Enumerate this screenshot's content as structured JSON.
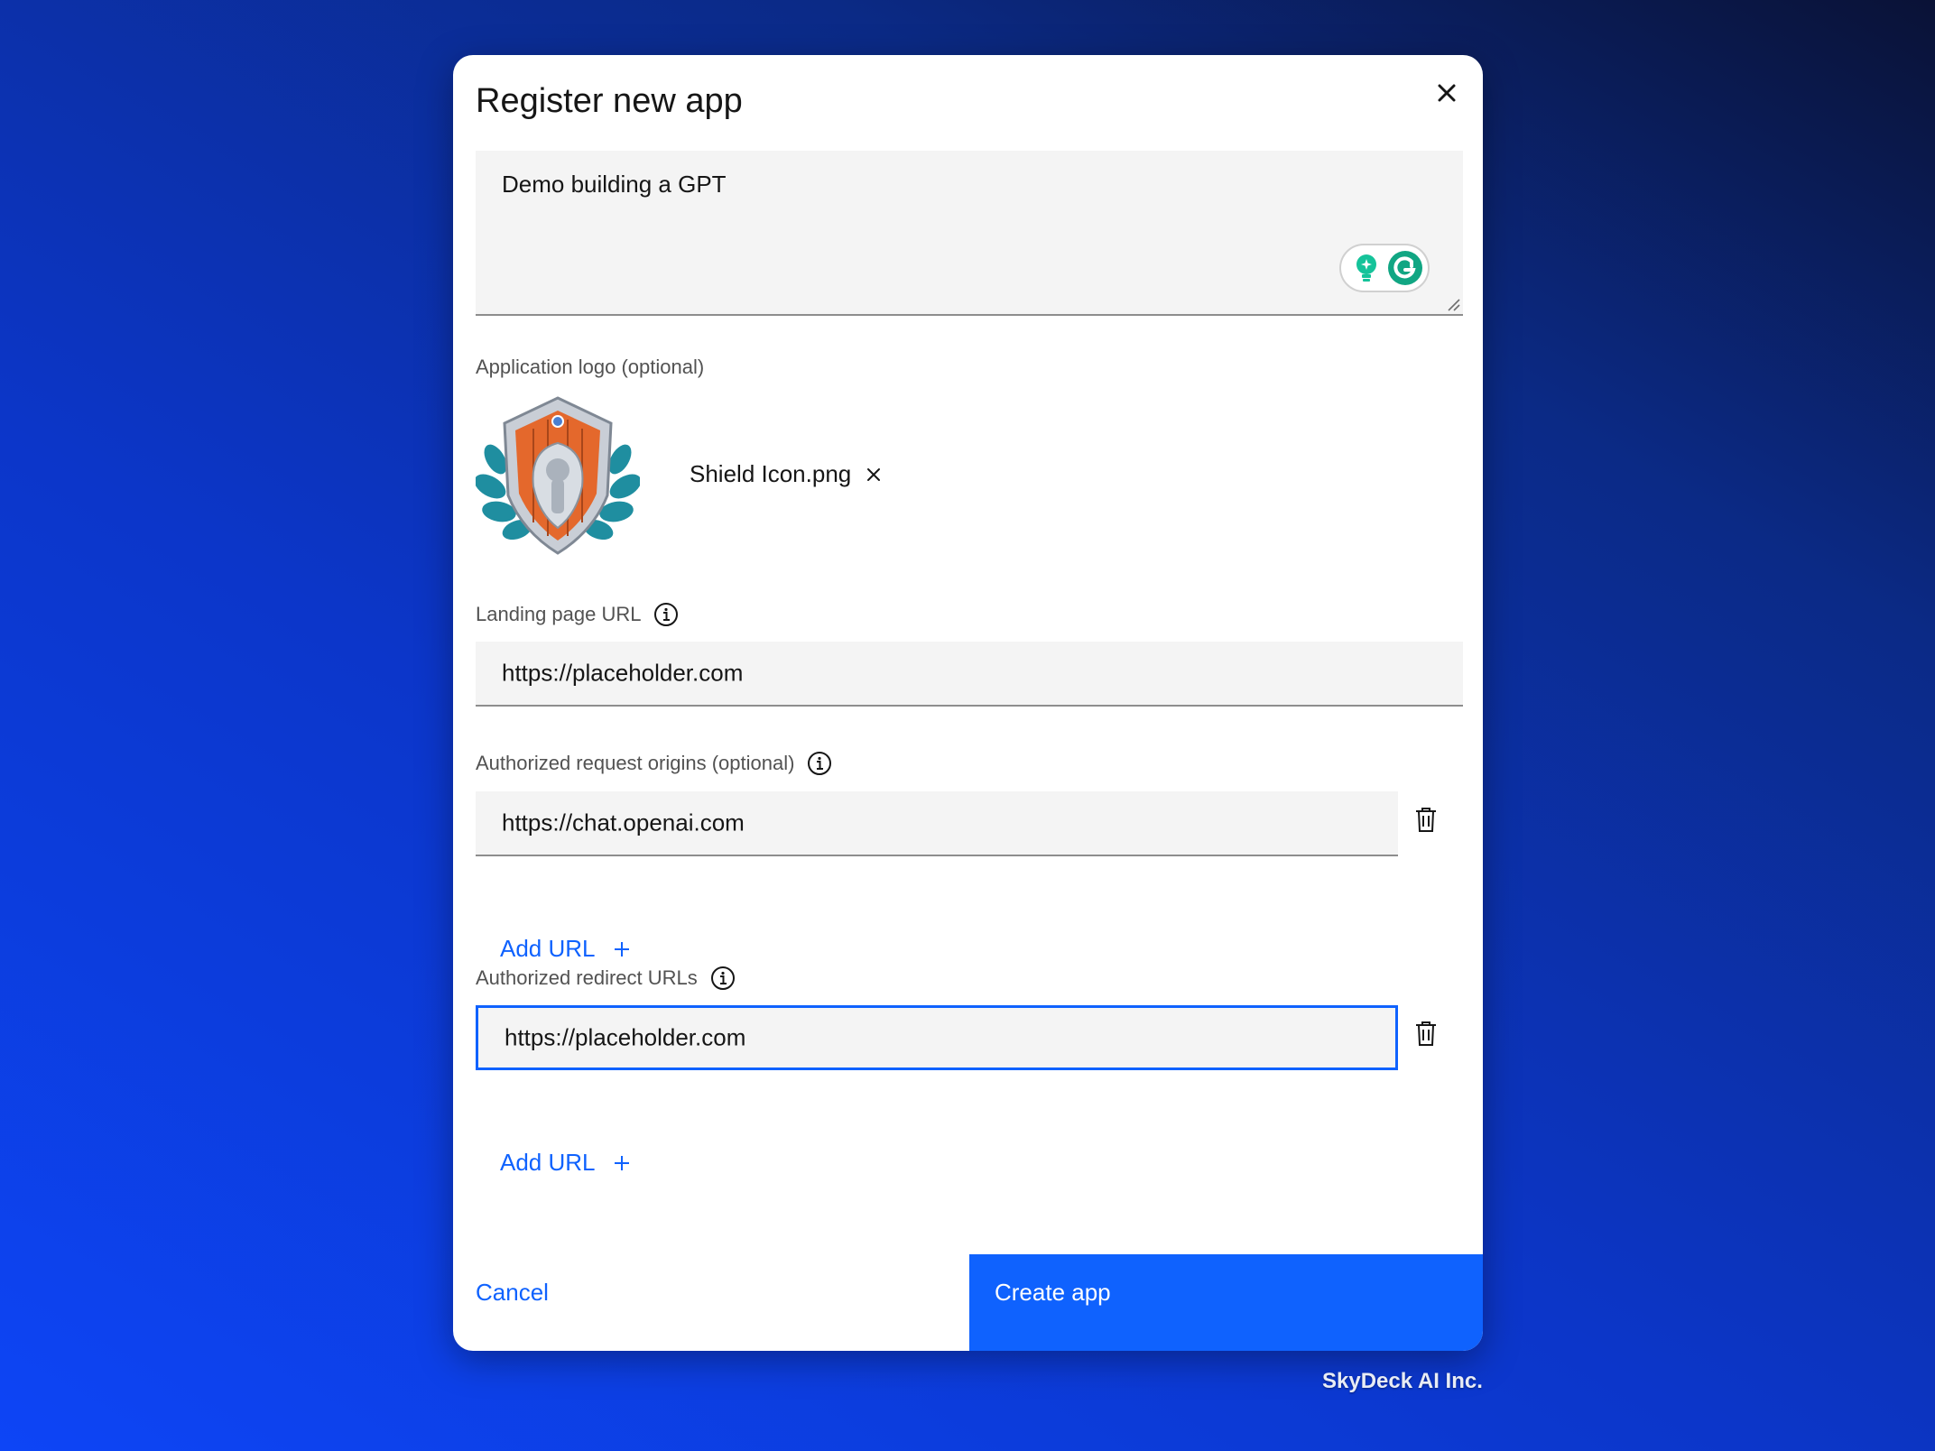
{
  "dialog": {
    "title": "Register new app",
    "description_value": "Demo building a GPT",
    "logo_label": "Application logo (optional)",
    "logo_file_name": "Shield Icon.png",
    "landing_label": "Landing page URL",
    "landing_value": "https://placeholder.com",
    "origins_label": "Authorized request origins (optional)",
    "origins_value": "https://chat.openai.com",
    "add_url_label": "Add URL",
    "redirect_label": "Authorized redirect URLs",
    "redirect_value": "https://placeholder.com",
    "cancel_label": "Cancel",
    "create_label": "Create app"
  },
  "brand": "SkyDeck AI Inc.",
  "colors": {
    "accent": "#0f62fe",
    "field_bg": "#f4f4f4",
    "grammarly": "#15c39a"
  },
  "icons": [
    "close-icon",
    "grammarly-bulb-icon",
    "grammarly-icon",
    "info-icon",
    "remove-file-icon",
    "trash-icon",
    "plus-icon",
    "shield-logo"
  ]
}
